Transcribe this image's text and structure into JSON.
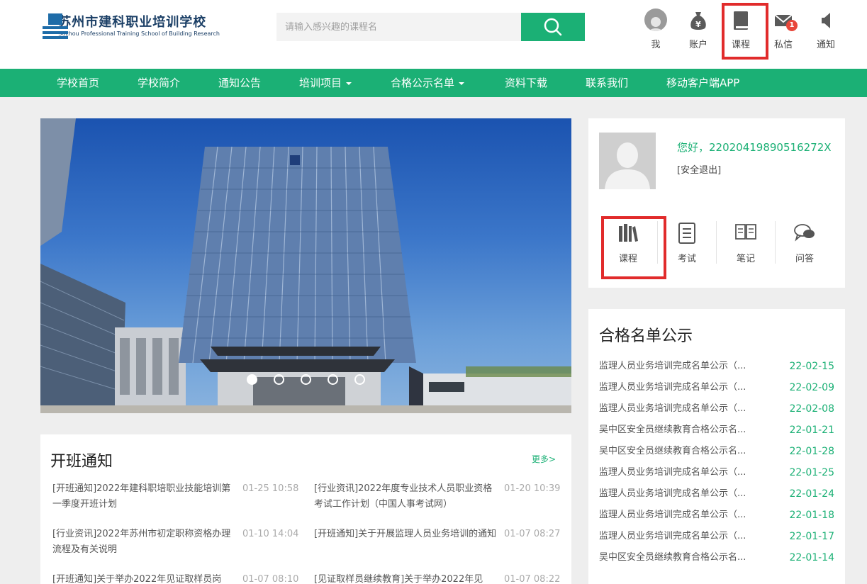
{
  "header": {
    "logo_cn": "苏州市建科职业培训学校",
    "logo_en": "Suzhou Professional Training School of Building Research",
    "search_placeholder": "请输入感兴趣的课程名",
    "top_icons": [
      {
        "label": "我",
        "icon": "user-avatar-icon"
      },
      {
        "label": "账户",
        "icon": "money-bag-icon"
      },
      {
        "label": "课程",
        "icon": "book-icon"
      },
      {
        "label": "私信",
        "icon": "envelope-icon",
        "badge": "1"
      },
      {
        "label": "通知",
        "icon": "speaker-icon"
      }
    ]
  },
  "nav": {
    "items": [
      {
        "label": "学校首页"
      },
      {
        "label": "学校简介"
      },
      {
        "label": "通知公告"
      },
      {
        "label": "培训项目"
      },
      {
        "label": "合格公示名单"
      },
      {
        "label": "资料下载"
      },
      {
        "label": "联系我们"
      },
      {
        "label": "移动客户端APP"
      }
    ]
  },
  "profile": {
    "greeting": "您好，22020419890516272X",
    "logout": "[安全退出]",
    "items": [
      {
        "label": "课程",
        "icon": "books-icon"
      },
      {
        "label": "考试",
        "icon": "exam-paper-icon"
      },
      {
        "label": "笔记",
        "icon": "open-book-icon"
      },
      {
        "label": "问答",
        "icon": "chat-bubbles-icon"
      }
    ]
  },
  "notice": {
    "title": "开班通知",
    "more": "更多>",
    "items": [
      {
        "title": "[开班通知]2022年建科职培职业技能培训第一季度开班计划",
        "date": "01-25 10:58"
      },
      {
        "title": "[行业资讯]2022年度专业技术人员职业资格考试工作计划（中国人事考试网）",
        "date": "01-20 10:39"
      },
      {
        "title": "[行业资讯]2022年苏州市初定职称资格办理流程及有关说明",
        "date": "01-10 14:04"
      },
      {
        "title": "[开班通知]关于开展监理人员业务培训的通知",
        "date": "01-07 08:27"
      },
      {
        "title": "[开班通知]关于举办2022年见证取样员岗",
        "date": "01-07 08:10"
      },
      {
        "title": "[见证取样员继续教育]关于举办2022年见",
        "date": "01-07 08:22"
      }
    ]
  },
  "qualified": {
    "title": "合格名单公示",
    "items": [
      {
        "title": "监理人员业务培训完成名单公示（...",
        "date": "22-02-15"
      },
      {
        "title": "监理人员业务培训完成名单公示（...",
        "date": "22-02-09"
      },
      {
        "title": "监理人员业务培训完成名单公示（...",
        "date": "22-02-08"
      },
      {
        "title": "吴中区安全员继续教育合格公示名...",
        "date": "22-01-21"
      },
      {
        "title": "吴中区安全员继续教育合格公示名...",
        "date": "22-01-28"
      },
      {
        "title": "监理人员业务培训完成名单公示（...",
        "date": "22-01-25"
      },
      {
        "title": "监理人员业务培训完成名单公示（...",
        "date": "22-01-24"
      },
      {
        "title": "监理人员业务培训完成名单公示（...",
        "date": "22-01-18"
      },
      {
        "title": "监理人员业务培训完成名单公示（...",
        "date": "22-01-17"
      },
      {
        "title": "吴中区安全员继续教育合格公示名...",
        "date": "22-01-14"
      }
    ]
  },
  "banner": {
    "active_slide": 1,
    "slide_count": 5
  },
  "colors": {
    "accent": "#1bb075",
    "highlight": "#e12b2b",
    "brand": "#1b3f66"
  }
}
